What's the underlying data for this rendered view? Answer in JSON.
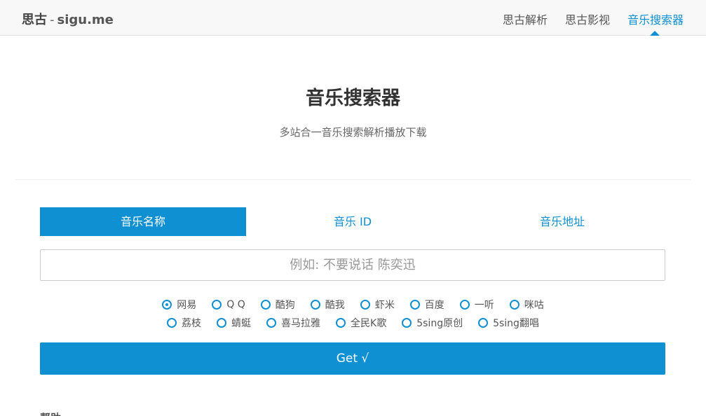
{
  "header": {
    "brand_main": "思古",
    "brand_sep": "-",
    "brand_domain": "sigu.me",
    "nav": [
      {
        "label": "思古解析",
        "active": false
      },
      {
        "label": "思古影视",
        "active": false
      },
      {
        "label": "音乐搜索器",
        "active": true
      }
    ]
  },
  "main": {
    "title": "音乐搜索器",
    "subtitle": "多站合一音乐搜索解析播放下载",
    "tabs": [
      {
        "label": "音乐名称",
        "active": true
      },
      {
        "label": "音乐 ID",
        "active": false
      },
      {
        "label": "音乐地址",
        "active": false
      }
    ],
    "search": {
      "value": "",
      "placeholder": "例如: 不要说话 陈奕迅"
    },
    "sources_row1": [
      {
        "label": "网易",
        "checked": true
      },
      {
        "label": "Q Q",
        "checked": false
      },
      {
        "label": "酷狗",
        "checked": false
      },
      {
        "label": "酷我",
        "checked": false
      },
      {
        "label": "虾米",
        "checked": false
      },
      {
        "label": "百度",
        "checked": false
      },
      {
        "label": "一听",
        "checked": false
      },
      {
        "label": "咪咕",
        "checked": false
      }
    ],
    "sources_row2": [
      {
        "label": "荔枝",
        "checked": false
      },
      {
        "label": "蜻蜓",
        "checked": false
      },
      {
        "label": "喜马拉雅",
        "checked": false
      },
      {
        "label": "全民K歌",
        "checked": false
      },
      {
        "label": "5sing原创",
        "checked": false
      },
      {
        "label": "5sing翻唱",
        "checked": false
      }
    ],
    "get_button_label": "Get √",
    "help_label": "帮助"
  },
  "colors": {
    "accent": "#0e90d2",
    "header_bg": "#f8f8f8"
  }
}
